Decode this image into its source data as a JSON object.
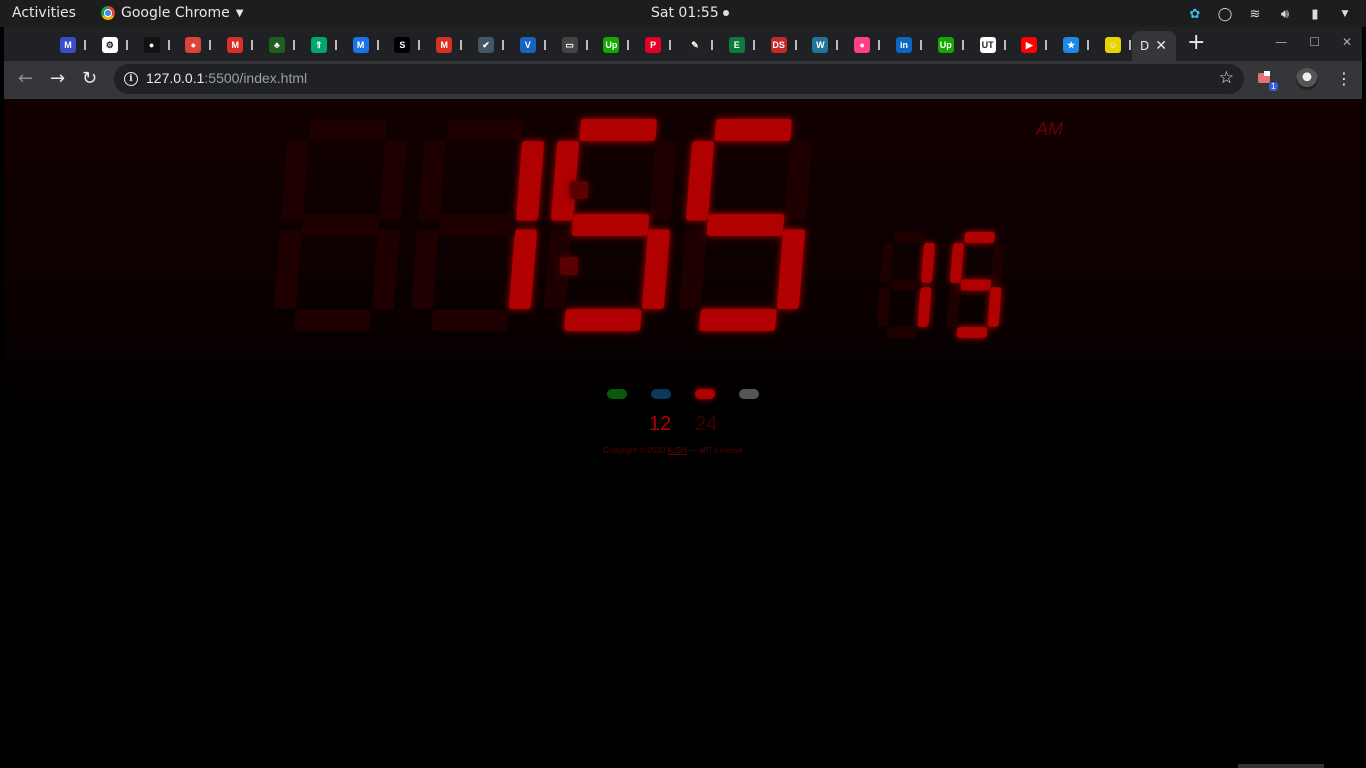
{
  "topbar": {
    "activities": "Activities",
    "app_name": "Google Chrome",
    "datetime": "Sat 01:55"
  },
  "browser": {
    "url_host": "127.0.0.1",
    "url_rest": ":5500/index.html",
    "active_tab_letter": "D",
    "extension_badge": "1",
    "tabs": [
      {
        "icon": "m-icon",
        "color": "#3b4cca",
        "label": "M"
      },
      {
        "icon": "puzzle-icon",
        "color": "#ffffff",
        "label": "⚙"
      },
      {
        "icon": "github-icon",
        "color": "#111111",
        "label": "●"
      },
      {
        "icon": "chrome-icon",
        "color": "#db4437",
        "label": "●"
      },
      {
        "icon": "gmail-icon",
        "color": "#d93025",
        "label": "M"
      },
      {
        "icon": "palm-icon",
        "color": "#1e5e1e",
        "label": "♣"
      },
      {
        "icon": "arrow-up-icon",
        "color": "#00a86b",
        "label": "⇑"
      },
      {
        "icon": "mail-icon",
        "color": "#1a73e8",
        "label": "M"
      },
      {
        "icon": "s-icon",
        "color": "#000000",
        "label": "S"
      },
      {
        "icon": "gmail-icon",
        "color": "#d93025",
        "label": "M"
      },
      {
        "icon": "checklist-icon",
        "color": "#445566",
        "label": "✔"
      },
      {
        "icon": "v-icon",
        "color": "#1565c0",
        "label": "V"
      },
      {
        "icon": "terminal-icon",
        "color": "#444444",
        "label": "▭"
      },
      {
        "icon": "upwork-icon",
        "color": "#14a800",
        "label": "Up"
      },
      {
        "icon": "pinterest-icon",
        "color": "#e60023",
        "label": "P"
      },
      {
        "icon": "feather-icon",
        "color": "#222222",
        "label": "✎"
      },
      {
        "icon": "editor-icon",
        "color": "#0e7a3e",
        "label": "E"
      },
      {
        "icon": "ds-icon",
        "color": "#c62828",
        "label": "DS"
      },
      {
        "icon": "wordpress-icon",
        "color": "#21759b",
        "label": "W"
      },
      {
        "icon": "color-wheel-icon",
        "color": "#ff4081",
        "label": "●"
      },
      {
        "icon": "linkedin-icon",
        "color": "#0a66c2",
        "label": "in"
      },
      {
        "icon": "upwork-icon",
        "color": "#14a800",
        "label": "Up"
      },
      {
        "icon": "ut-icon",
        "color": "#ffffff",
        "label": "UT"
      },
      {
        "icon": "youtube-icon",
        "color": "#ff0000",
        "label": "▶"
      },
      {
        "icon": "star-badge-icon",
        "color": "#1e88e5",
        "label": "★"
      },
      {
        "icon": "smiley-icon",
        "color": "#e6d300",
        "label": "☺"
      }
    ]
  },
  "clock": {
    "hours": "01",
    "minutes": "55",
    "seconds": "15",
    "period": "AM",
    "segment_on": "#b00000",
    "segment_off": "#1e0000"
  },
  "controls": {
    "colors": [
      "#0a5a0a",
      "#0a3a5a",
      "#b00000",
      "#555555"
    ],
    "format_12": "12",
    "format_24": "24"
  },
  "footer": {
    "prefix": "Copyright © 2020",
    "author": "KrSH",
    "suffix": "— MIT License"
  }
}
